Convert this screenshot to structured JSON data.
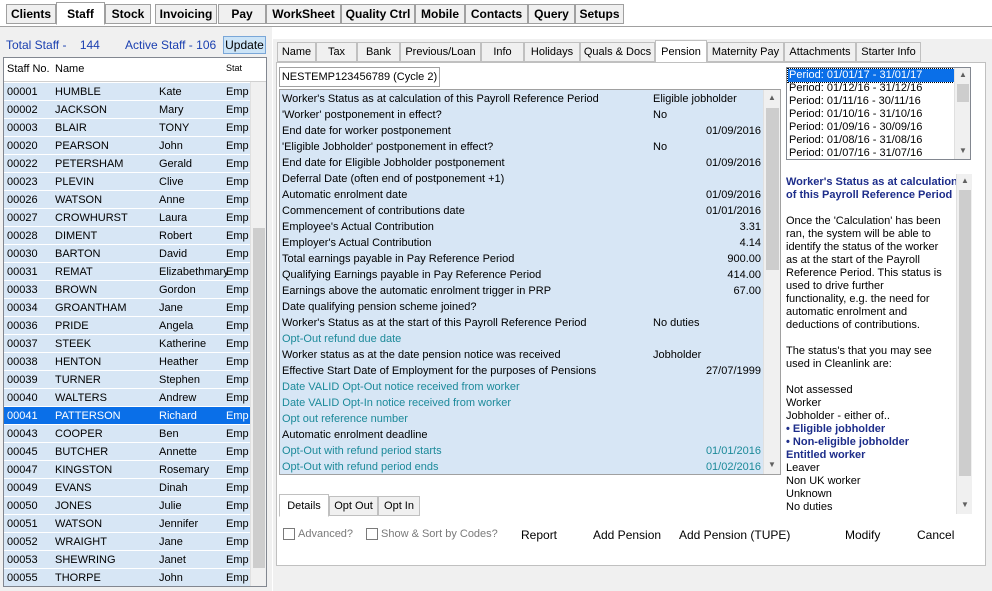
{
  "top_menu": [
    "Clients",
    "Staff",
    "Stock",
    "Invoicing",
    "Pay",
    "WorkSheet",
    "Quality Ctrl",
    "Mobile",
    "Contacts",
    "Query",
    "Setups"
  ],
  "active_top": "Staff",
  "left": {
    "total_staff_label": "Total Staff -",
    "total_staff": "144",
    "active_staff_label": "Active Staff -",
    "active_staff": "106",
    "update_label": "Update",
    "headers": {
      "no": "Staff No.",
      "name": "Name",
      "first": "",
      "stat": "Stat"
    },
    "rows": [
      [
        "00001",
        "HUMBLE",
        "Kate",
        "Emp"
      ],
      [
        "00002",
        "JACKSON",
        "Mary",
        "Emp"
      ],
      [
        "00003",
        "BLAIR",
        "TONY",
        "Emp"
      ],
      [
        "00020",
        "PEARSON",
        "John",
        "Emp"
      ],
      [
        "00022",
        "PETERSHAM",
        "Gerald",
        "Emp"
      ],
      [
        "00023",
        "PLEVIN",
        "Clive",
        "Emp"
      ],
      [
        "00026",
        "WATSON",
        "Anne",
        "Emp"
      ],
      [
        "00027",
        "CROWHURST",
        "Laura",
        "Emp"
      ],
      [
        "00028",
        "DIMENT",
        "Robert",
        "Emp"
      ],
      [
        "00030",
        "BARTON",
        "David",
        "Emp"
      ],
      [
        "00031",
        "REMAT",
        "Elizabethmary",
        "Emp"
      ],
      [
        "00033",
        "BROWN",
        "Gordon",
        "Emp"
      ],
      [
        "00034",
        "GROANTHAM",
        "Jane",
        "Emp"
      ],
      [
        "00036",
        "PRIDE",
        "Angela",
        "Emp"
      ],
      [
        "00037",
        "STEEK",
        "Katherine",
        "Emp"
      ],
      [
        "00038",
        "HENTON",
        "Heather",
        "Emp"
      ],
      [
        "00039",
        "TURNER",
        "Stephen",
        "Emp"
      ],
      [
        "00040",
        "WALTERS",
        "Andrew",
        "Emp"
      ],
      [
        "00041",
        "PATTERSON",
        "Richard",
        "Emp"
      ],
      [
        "00043",
        "COOPER",
        "Ben",
        "Emp"
      ],
      [
        "00045",
        "BUTCHER",
        "Annette",
        "Emp"
      ],
      [
        "00047",
        "KINGSTON",
        "Rosemary",
        "Emp"
      ],
      [
        "00049",
        "EVANS",
        "Dinah",
        "Emp"
      ],
      [
        "00050",
        "JONES",
        "Julie",
        "Emp"
      ],
      [
        "00051",
        "WATSON",
        "Jennifer",
        "Emp"
      ],
      [
        "00052",
        "WRAIGHT",
        "Jane",
        "Emp"
      ],
      [
        "00053",
        "SHEWRING",
        "Janet",
        "Emp"
      ],
      [
        "00055",
        "THORPE",
        "John",
        "Emp"
      ]
    ],
    "selected_row": 18
  },
  "tabs": [
    "Name",
    "Tax",
    "Bank",
    "Previous/Loan",
    "Info",
    "Holidays",
    "Quals & Docs",
    "Pension",
    "Maternity Pay",
    "Attachments",
    "Starter Info"
  ],
  "active_tab": "Pension",
  "cycle_tab": "NESTEMP123456789 (Cycle 2)",
  "pension_rows": [
    {
      "label": "Worker's Status as at calculation of this Payroll Reference Period",
      "value": "Eligible jobholder",
      "align": "left",
      "teal": false
    },
    {
      "label": "'Worker' postponement in effect?",
      "value": "No",
      "align": "left",
      "teal": false
    },
    {
      "label": "End date for worker postponement",
      "value": "01/09/2016",
      "align": "right",
      "teal": false
    },
    {
      "label": "'Eligible Jobholder' postponement in effect?",
      "value": "No",
      "align": "left",
      "teal": false
    },
    {
      "label": "End date for Eligible Jobholder postponement",
      "value": "01/09/2016",
      "align": "right",
      "teal": false
    },
    {
      "label": "Deferral Date (often end of postponement +1)",
      "value": "",
      "align": "right",
      "teal": false
    },
    {
      "label": "Automatic enrolment date",
      "value": "01/09/2016",
      "align": "right",
      "teal": false
    },
    {
      "label": "Commencement of contributions date",
      "value": "01/01/2016",
      "align": "right",
      "teal": false
    },
    {
      "label": "Employee's Actual Contribution",
      "value": "3.31",
      "align": "right",
      "teal": false
    },
    {
      "label": "Employer's Actual Contribution",
      "value": "4.14",
      "align": "right",
      "teal": false
    },
    {
      "label": "Total earnings payable in Pay Reference Period",
      "value": "900.00",
      "align": "right",
      "teal": false
    },
    {
      "label": "Qualifying Earnings payable in Pay Reference Period",
      "value": "414.00",
      "align": "right",
      "teal": false
    },
    {
      "label": "Earnings above the automatic enrolment trigger in PRP",
      "value": "67.00",
      "align": "right",
      "teal": false
    },
    {
      "label": "Date qualifying pension scheme joined?",
      "value": "",
      "align": "right",
      "teal": false
    },
    {
      "label": "Worker's Status as at the start of this Payroll Reference Period",
      "value": "No duties",
      "align": "left",
      "teal": false
    },
    {
      "label": "Opt-Out refund due date",
      "value": "",
      "align": "right",
      "teal": true
    },
    {
      "label": "Worker status as at the date pension notice was received",
      "value": "Jobholder",
      "align": "left",
      "teal": false
    },
    {
      "label": "Effective Start Date of Employment for the purposes of Pensions",
      "value": "27/07/1999",
      "align": "right",
      "teal": false
    },
    {
      "label": "Date VALID Opt-Out notice received from worker",
      "value": "",
      "align": "right",
      "teal": true
    },
    {
      "label": "Date VALID Opt-In notice received from worker",
      "value": "",
      "align": "right",
      "teal": true
    },
    {
      "label": "Opt out reference number",
      "value": "",
      "align": "right",
      "teal": true
    },
    {
      "label": "Automatic enrolment deadline",
      "value": "",
      "align": "right",
      "teal": false
    },
    {
      "label": "Opt-Out with refund period starts",
      "value": "01/01/2016",
      "align": "right",
      "teal": true
    },
    {
      "label": "Opt-Out with refund period ends",
      "value": "01/02/2016",
      "align": "right",
      "teal": true
    }
  ],
  "sub_tabs": [
    "Details",
    "Opt Out",
    "Opt In"
  ],
  "active_sub_tab": "Details",
  "options": {
    "advanced": "Advanced?",
    "show_sort": "Show & Sort by Codes?"
  },
  "actions": {
    "report": "Report",
    "add_pension": "Add Pension",
    "add_pension_tupe": "Add Pension (TUPE)",
    "modify": "Modify",
    "cancel": "Cancel"
  },
  "periods": [
    "Period: 01/01/17 - 31/01/17",
    "Period: 01/12/16 - 31/12/16",
    "Period: 01/11/16 - 30/11/16",
    "Period: 01/10/16 - 31/10/16",
    "Period: 01/09/16 - 30/09/16",
    "Period: 01/08/16 - 31/08/16",
    "Period: 01/07/16 - 31/07/16"
  ],
  "help": [
    {
      "t": "Worker's Status as at calculation",
      "c": "blue"
    },
    {
      "t": "of this Payroll Reference Period",
      "c": "blue"
    },
    {
      "t": "",
      "c": ""
    },
    {
      "t": "Once the 'Calculation' has been",
      "c": ""
    },
    {
      "t": "ran, the system will be able to",
      "c": ""
    },
    {
      "t": "identify the status of the worker",
      "c": ""
    },
    {
      "t": "as at the start of the Payroll",
      "c": ""
    },
    {
      "t": "Reference Period. This status is",
      "c": ""
    },
    {
      "t": "used to drive further",
      "c": ""
    },
    {
      "t": "functionality, e.g. the need for",
      "c": ""
    },
    {
      "t": "automatic enrolment and",
      "c": ""
    },
    {
      "t": "deductions of contributions.",
      "c": ""
    },
    {
      "t": "",
      "c": ""
    },
    {
      "t": "The status's that you may see",
      "c": ""
    },
    {
      "t": "used in Cleanlink are:",
      "c": ""
    },
    {
      "t": "",
      "c": ""
    },
    {
      "t": "Not assessed",
      "c": ""
    },
    {
      "t": "Worker",
      "c": ""
    },
    {
      "t": "Jobholder - either of..",
      "c": "mixed"
    },
    {
      "t": "• Eligible jobholder",
      "c": "blue"
    },
    {
      "t": "• Non-eligible jobholder",
      "c": "blue"
    },
    {
      "t": "Entitled worker",
      "c": "blue"
    },
    {
      "t": "Leaver",
      "c": ""
    },
    {
      "t": "Non UK worker",
      "c": ""
    },
    {
      "t": "Unknown",
      "c": ""
    },
    {
      "t": "No duties",
      "c": ""
    }
  ]
}
